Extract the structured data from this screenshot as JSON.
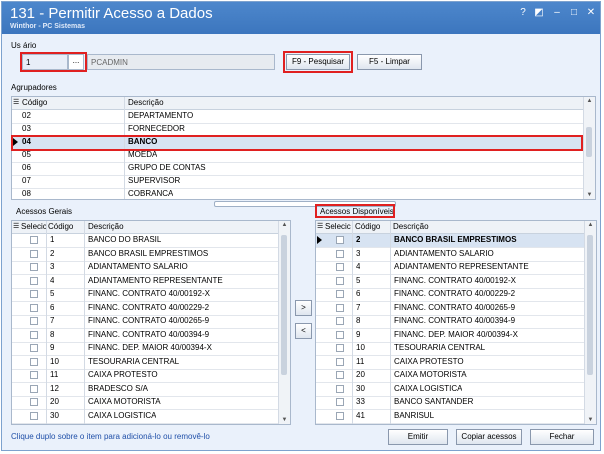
{
  "window": {
    "title": "131 - Permitir Acesso a Dados",
    "subtitle": "Winthor - PC Sistemas",
    "controls": [
      "?",
      "◩",
      "–",
      "□",
      "✕"
    ]
  },
  "user": {
    "label": "Us ário",
    "code": "1",
    "lookup": "...",
    "name": "PCADMIN"
  },
  "buttons": {
    "search": "F9 - Pesquisar",
    "clear": "F5 - Limpar",
    "add": ">",
    "remove": "<",
    "emit": "Emitir",
    "copy": "Copiar acessos",
    "close": "Fechar"
  },
  "groupers": {
    "label": "Agrupadores",
    "columns": [
      "Código",
      "Descrição"
    ],
    "rows": [
      [
        "02",
        "DEPARTAMENTO"
      ],
      [
        "03",
        "FORNECEDOR"
      ],
      [
        "04",
        "BANCO"
      ],
      [
        "05",
        "MOEDA"
      ],
      [
        "06",
        "GRUPO DE CONTAS"
      ],
      [
        "07",
        "SUPERVISOR"
      ],
      [
        "08",
        "COBRANCA"
      ]
    ]
  },
  "general_access": {
    "label": "Acessos Gerais",
    "columns": [
      "Selecic",
      "Código",
      "Descrição"
    ],
    "rows": [
      [
        "1",
        "BANCO DO BRASIL"
      ],
      [
        "2",
        "BANCO BRASIL EMPRESTIMOS"
      ],
      [
        "3",
        "ADIANTAMENTO SALARIO"
      ],
      [
        "4",
        "ADIANTAMENTO REPRESENTANTE"
      ],
      [
        "5",
        "FINANC. CONTRATO 40/00192-X"
      ],
      [
        "6",
        "FINANC. CONTRATO 40/00229-2"
      ],
      [
        "7",
        "FINANC. CONTRATO 40/00265-9"
      ],
      [
        "8",
        "FINANC. CONTRATO 40/00394-9"
      ],
      [
        "9",
        "FINANC. DEP.  MAIOR 40/00394-X"
      ],
      [
        "10",
        "TESOURARIA CENTRAL"
      ],
      [
        "11",
        "CAIXA PROTESTO"
      ],
      [
        "12",
        "BRADESCO S/A"
      ],
      [
        "20",
        "CAIXA MOTORISTA"
      ],
      [
        "30",
        "CAIXA LOGISTICA"
      ]
    ]
  },
  "available_access": {
    "label": "Acessos Disponíveis",
    "columns": [
      "Selecic",
      "Código",
      "Descrição"
    ],
    "rows": [
      [
        "2",
        "BANCO BRASIL EMPRESTIMOS"
      ],
      [
        "3",
        "ADIANTAMENTO SALARIO"
      ],
      [
        "4",
        "ADIANTAMENTO REPRESENTANTE"
      ],
      [
        "5",
        "FINANC. CONTRATO 40/00192-X"
      ],
      [
        "6",
        "FINANC. CONTRATO 40/00229-2"
      ],
      [
        "7",
        "FINANC. CONTRATO 40/00265-9"
      ],
      [
        "8",
        "FINANC. CONTRATO 40/00394-9"
      ],
      [
        "9",
        "FINANC. DEP.  MAIOR 40/00394-X"
      ],
      [
        "10",
        "TESOURARIA CENTRAL"
      ],
      [
        "11",
        "CAIXA PROTESTO"
      ],
      [
        "20",
        "CAIXA MOTORISTA"
      ],
      [
        "30",
        "CAIXA LOGISTICA"
      ],
      [
        "33",
        "BANCO SANTANDER"
      ],
      [
        "41",
        "BANRISUL"
      ]
    ]
  },
  "footer": {
    "hint": "Clique duplo sobre o item para adicioná-lo ou removê-lo"
  },
  "colors": {
    "titlebar": "#3c76be",
    "highlight": "#e02020",
    "selected_row": "#d7e3f2",
    "hint": "#1f4fa8"
  }
}
